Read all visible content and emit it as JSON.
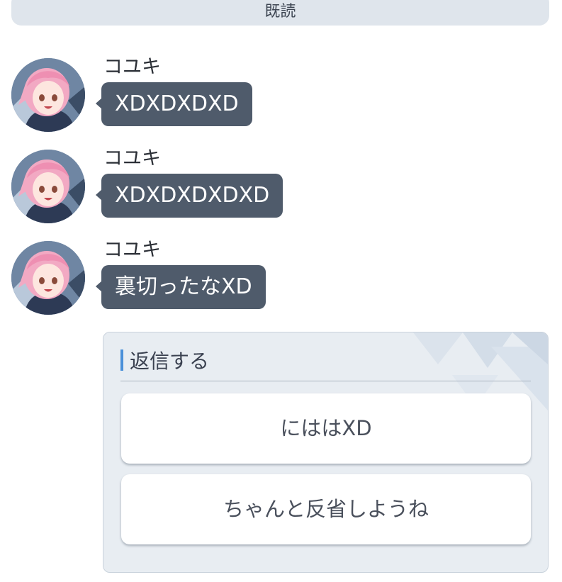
{
  "top_bar": {
    "label": "既読"
  },
  "messages": [
    {
      "sender": "コユキ",
      "text": "XDXDXDXD",
      "avatar_icon": "character-avatar"
    },
    {
      "sender": "コユキ",
      "text": "XDXDXDXDXD",
      "avatar_icon": "character-avatar"
    },
    {
      "sender": "コユキ",
      "text": "裏切ったなXD",
      "avatar_icon": "character-avatar"
    }
  ],
  "reply": {
    "title": "返信する",
    "options": [
      {
        "label": "にははXD"
      },
      {
        "label": "ちゃんと反省しようね"
      }
    ]
  },
  "colors": {
    "bubble": "#4f5b6b",
    "accent": "#4a90d9",
    "panel": "#e8edf2"
  }
}
